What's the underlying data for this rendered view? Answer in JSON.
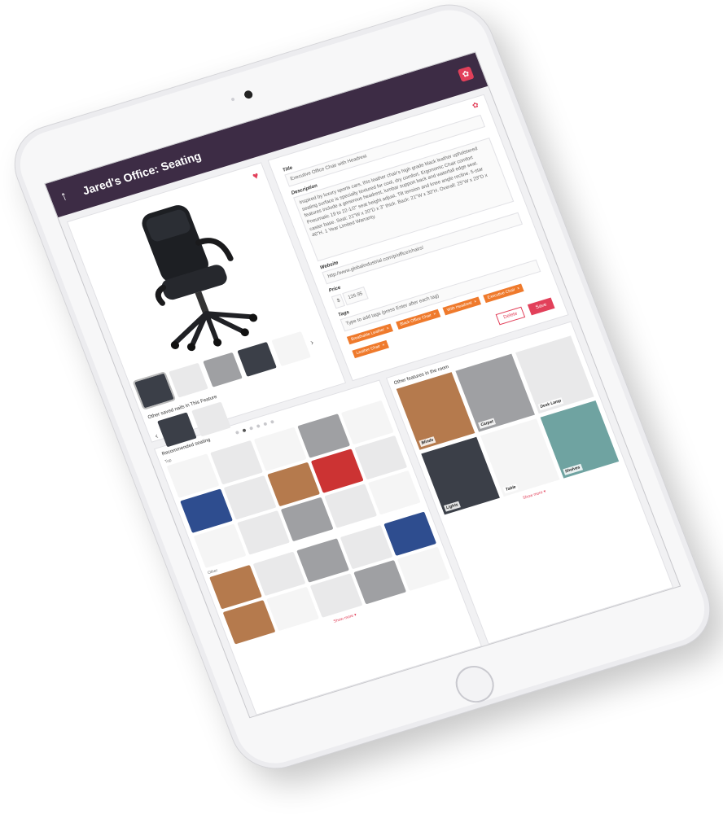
{
  "header": {
    "back_icon": "back-arrow-icon",
    "title": "Jared's Office: Seating",
    "settings_icon": "gear-icon"
  },
  "product": {
    "favorite_icon": "heart-icon",
    "saved_label": "Other saved nails in This Feature",
    "thumbnail_count": 5,
    "saved_count": 2,
    "carousel_dots": 6,
    "active_dot": 1
  },
  "form": {
    "gear_icon": "gear-icon",
    "title_label": "Title",
    "title_value": "Executive Office Chair with Headrest",
    "description_label": "Description",
    "description_value": "Inspired by luxury sports cars, this leather chair's high grade black leather upholstered seating surface is specially textured for cool, dry comfort. Ergonomic Chair comfort features include a generous headrest, lumbar support back and waterfall edge seat. Pneumatic 19 to 22-1/2\" seat height adjust. Tilt tension and knee angle recline. 5-star caster base. Seat: 21\"W x 20\"D x 3\" thick. Back: 21\"W x 30\"H. Overall: 25\"W x 29\"D x 46\"H. 1 Year Limited Warranty.",
    "website_label": "Website",
    "website_value": "http://www.globalindustrial.com/p/office/chairs/",
    "price_label": "Price",
    "price_currency": "$",
    "price_value": "126.95",
    "tags_label": "Tags",
    "tags_placeholder": "Type to add tags (press Enter after each tag)",
    "tags": [
      "Breathable Leather",
      "Black Office Chair",
      "With Headrest",
      "Executive Chair",
      "Leather Chair"
    ],
    "delete_label": "Delete",
    "save_label": "Save"
  },
  "recommended": {
    "title": "Recommended seating",
    "top_label": "Top",
    "other_label": "Other",
    "show_more": "Show more"
  },
  "features": {
    "title": "Other features in the room",
    "items": [
      "Blinds",
      "Carpet",
      "Desk Lamp",
      "Lights",
      "Table",
      "Shelves"
    ],
    "show_more": "Show more"
  },
  "colors": {
    "header_bg": "#3d2c45",
    "accent": "#e2405a",
    "tag": "#ef7a2c"
  }
}
